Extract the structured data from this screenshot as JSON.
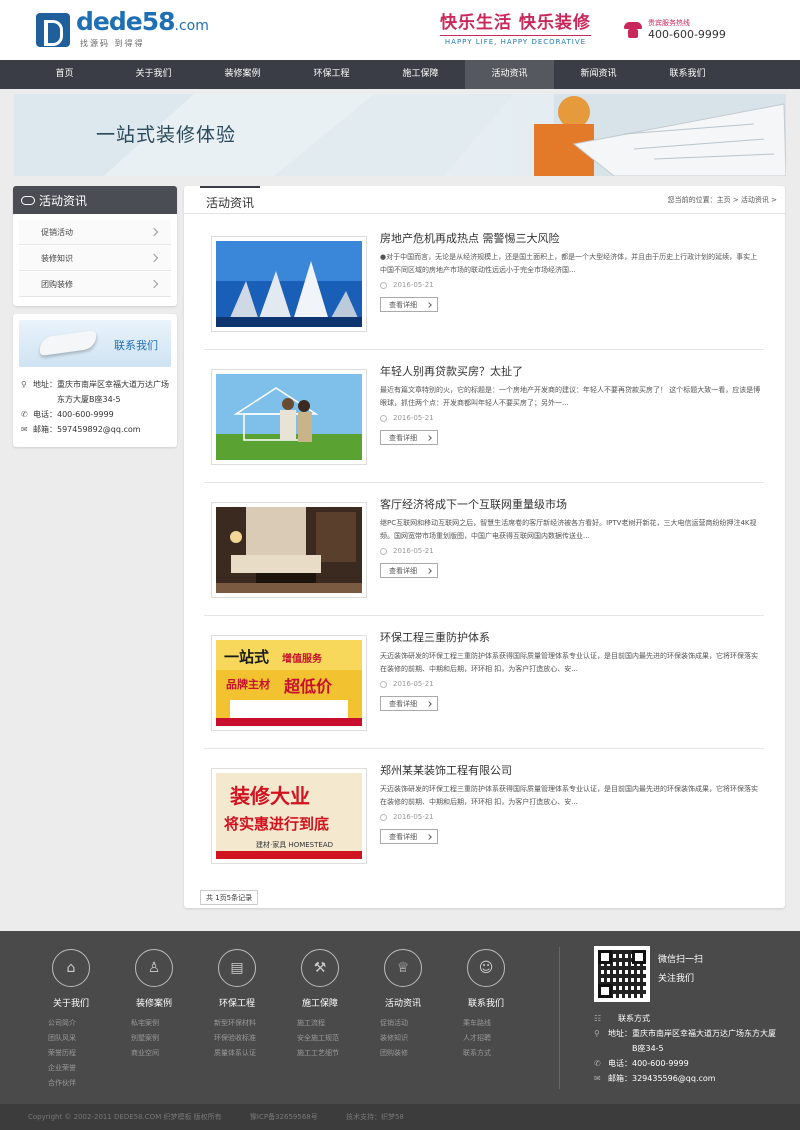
{
  "header": {
    "logo_main": "dede58",
    "logo_com": ".com",
    "logo_sub": "找源码 到得得",
    "slogan_cn": "快乐生活 快乐装修",
    "slogan_en": "HAPPY LIFE, HAPPY DECORATIVE",
    "hotline_label": "贵宾服务热线",
    "hotline_number": "400-600-9999"
  },
  "nav": {
    "items": [
      {
        "label": "首页"
      },
      {
        "label": "关于我们"
      },
      {
        "label": "装修案例"
      },
      {
        "label": "环保工程"
      },
      {
        "label": "施工保障"
      },
      {
        "label": "活动资讯"
      },
      {
        "label": "新闻资讯"
      },
      {
        "label": "联系我们"
      }
    ],
    "active_index": 5
  },
  "banner": {
    "title": "一站式装修体验"
  },
  "sidebar": {
    "category_title": "活动资讯",
    "categories": [
      {
        "label": "促销活动"
      },
      {
        "label": "装修知识"
      },
      {
        "label": "团购装修"
      }
    ],
    "contact": {
      "title": "联系我们",
      "address_label": "地址：",
      "address": "重庆市南岸区幸福大道万达广场东方大厦B座34-5",
      "phone_label": "电话：",
      "phone": "400-600-9999",
      "email_label": "邮箱：",
      "email": "597459892@qq.com"
    }
  },
  "main": {
    "title": "活动资讯",
    "breadcrumb": "您当前的位置：主页 > 活动资讯 >",
    "read_more": "查看详细",
    "articles": [
      {
        "title": "房地产危机再成热点 需警惕三大风险",
        "desc": "●对于中国而言，无论是从经济规模上，还是国土面积上，都是一个大型经济体，并且由于历史上行政计划的延续，事实上中国不同区域的房地产市场的联动性远远小于完全市场经济国...",
        "date": "2016-05-21"
      },
      {
        "title": "年轻人别再贷款买房？太扯了",
        "desc": "最近有篇文章特别的火，它的标题是：一个房地产开发商的建议：年轻人不要再贷款买房了！ 这个标题大致一看，应该是博眼球，抓住两个点：开发商都叫年轻人不要买房了；另外一...",
        "date": "2016-05-21"
      },
      {
        "title": "客厅经济将成下一个互联网重量级市场",
        "desc": "继PC互联网和移动互联网之后，智慧生活席卷的客厅新经济被各方看好。IPTV老树开新花，三大电信运营商纷纷押注4K视频。国网宽带市场重划版图，中国广电获得互联网国内数据传送业...",
        "date": "2016-05-21"
      },
      {
        "title": "环保工程三重防护体系",
        "desc": "天迈装饰研发的环保工程三重防护体系获得国际质量管理体系专业认证，是目前国内最先进的环保装饰成果，它将环保落实在装修的前期、中期和后期，环环相 扣，为客户打造放心、安...",
        "date": "2016-05-21"
      },
      {
        "title": "郑州某某装饰工程有限公司",
        "desc": "天迈装饰研发的环保工程三重防护体系获得国际质量管理体系专业认证，是目前国内最先进的环保装饰成果，它将环保落实在装修的前期、中期和后期，环环相 扣，为客户打造放心、安...",
        "date": "2016-05-21"
      }
    ],
    "thumb_texts": {
      "promo_line1": "一站式",
      "promo_line2": "增值服务",
      "promo_line3": "品牌主材",
      "promo_line4": "超低价",
      "promo2_line1": "装修大业",
      "promo2_line2": "将实惠进行到底",
      "promo2_line3": "建材·家具 HOMESTEAD"
    },
    "pager": "共 1页5条记录"
  },
  "footer": {
    "columns": [
      {
        "title": "关于我们",
        "icon": "house-icon",
        "links": [
          "公司简介",
          "团队风采",
          "荣誉历程",
          "企业荣誉",
          "合作伙伴"
        ]
      },
      {
        "title": "装修案例",
        "icon": "lamp-icon",
        "links": [
          "私宅案例",
          "别墅案例",
          "商业空间"
        ]
      },
      {
        "title": "环保工程",
        "icon": "roller-icon",
        "links": [
          "新型环保材料",
          "环保验收标准",
          "质量体系认证"
        ]
      },
      {
        "title": "施工保障",
        "icon": "hammer-icon",
        "links": [
          "施工流程",
          "安全施工规范",
          "施工工艺细节"
        ]
      },
      {
        "title": "活动资讯",
        "icon": "trophy-icon",
        "links": [
          "促销活动",
          "装修知识",
          "团购装修"
        ]
      },
      {
        "title": "联系我们",
        "icon": "people-icon",
        "links": [
          "乘车路线",
          "人才招聘",
          "联系方式"
        ]
      }
    ],
    "qr_caption_1": "微信扫一扫",
    "qr_caption_2": "关注我们",
    "contact_title": "联系方式",
    "address_label": "地址：",
    "address": "重庆市南岸区幸福大道万达广场东方大厦B座34-5",
    "phone_label": "电话：",
    "phone": "400-600-9999",
    "email_label": "邮箱：",
    "email": "329435596@qq.com"
  },
  "copyright": {
    "text": "Copyright © 2002-2011 DEDE58.COM 织梦模板 版权所有",
    "icp": "豫ICP备32659568号",
    "support": "技术支持：织梦58"
  }
}
